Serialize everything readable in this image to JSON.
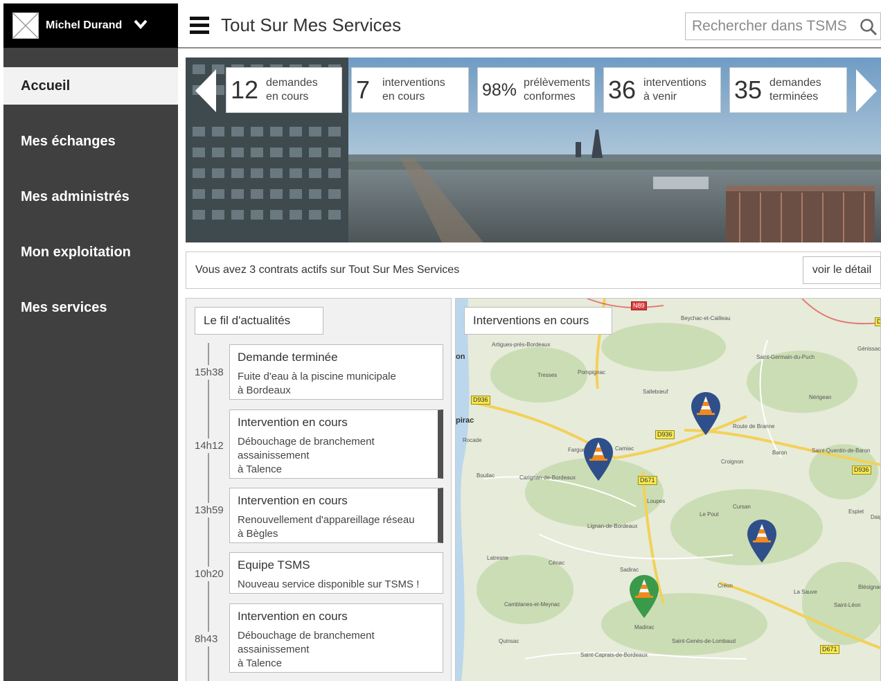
{
  "user": {
    "name": "Michel Durand"
  },
  "sidebar": {
    "items": [
      {
        "label": "Accueil",
        "active": true
      },
      {
        "label": "Mes échanges"
      },
      {
        "label": "Mes administrés"
      },
      {
        "label": "Mon exploitation"
      },
      {
        "label": "Mes services"
      }
    ]
  },
  "header": {
    "title": "Tout Sur Mes Services",
    "search_placeholder": "Rechercher dans TSMS"
  },
  "stats": [
    {
      "value": "12",
      "line1": "demandes",
      "line2": "en cours"
    },
    {
      "value": "7",
      "line1": "interventions",
      "line2": "en cours"
    },
    {
      "value": "98%",
      "line1": "prélèvements",
      "line2": "conformes"
    },
    {
      "value": "36",
      "line1": "interventions",
      "line2": "à venir"
    },
    {
      "value": "35",
      "line1": "demandes",
      "line2": "terminées"
    }
  ],
  "contracts": {
    "text": "Vous avez 3 contrats actifs sur Tout Sur Mes Services",
    "button": "voir le détail"
  },
  "feed": {
    "title": "Le fil d'actualités",
    "items": [
      {
        "time": "15h38",
        "title": "Demande terminée",
        "line1": "Fuite d'eau à la piscine municipale",
        "line2": "à Bordeaux",
        "line3": ""
      },
      {
        "time": "14h12",
        "title": "Intervention en cours",
        "line1": "Débouchage de branchement",
        "line2": "assainissement",
        "line3": "à Talence"
      },
      {
        "time": "13h59",
        "title": "Intervention en cours",
        "line1": "Renouvellement d'appareillage réseau",
        "line2": "à Bègles",
        "line3": ""
      },
      {
        "time": "10h20",
        "title": "Equipe TSMS",
        "line1": "Nouveau service disponible sur TSMS !",
        "line2": "",
        "line3": ""
      },
      {
        "time": "8h43",
        "title": "Intervention en cours",
        "line1": "Débouchage de branchement",
        "line2": "assainissement",
        "line3": "à Talence"
      }
    ]
  },
  "map": {
    "title": "Interventions en cours",
    "places": [
      "Beychac-et-Cailleau",
      "Artigues-près-Bordeaux",
      "Saint-Germain-du-Puch",
      "Génissac",
      "Tresses",
      "Pompignac",
      "Sallebœuf",
      "Nérigean",
      "Fargues",
      "Croignon",
      "Baron",
      "Saint-Quentin-de-Baron",
      "Bouliac",
      "Carignan-de-Bordeaux",
      "Loupes",
      "Camiac",
      "Espiet",
      "Daig",
      "Lignan-de-Bordeaux",
      "Le Pout",
      "Cursan",
      "Latresne",
      "Cénac",
      "Sadirac",
      "Créon",
      "La Sauve",
      "Blésignac",
      "Saint-Léon",
      "Camblanes-et-Meynac",
      "Quinsac",
      "Madirac",
      "Saint-Genès-de-Lombaud",
      "Saint-Caprais-de-Bordeaux",
      "Rocade",
      "Route de Branne",
      "on",
      "pirac"
    ],
    "roads": [
      "N89",
      "D936",
      "D936",
      "D671",
      "D936",
      "D671",
      "D"
    ],
    "marker_colors": {
      "active": "#2f4f8a",
      "done": "#3a9a4a"
    }
  }
}
